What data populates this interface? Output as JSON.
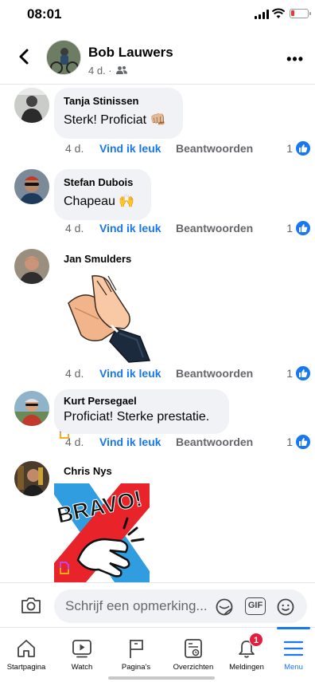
{
  "status_bar": {
    "time": "08:01"
  },
  "header": {
    "author": "Bob Lauwers",
    "meta": "4 d. ·",
    "audience_icon": "friends-icon",
    "back_icon": "chevron-left-icon",
    "more_label": "•••"
  },
  "comments": [
    {
      "author": "Tanja Stinissen",
      "text": "Sterk! Proficiat 👊🏼",
      "age": "4 d.",
      "like_label": "Vind ik leuk",
      "reply_label": "Beantwoorden",
      "reactions": "1"
    },
    {
      "author": "Stefan Dubois",
      "text": "Chapeau 🙌",
      "age": "4 d.",
      "like_label": "Vind ik leuk",
      "reply_label": "Beantwoorden",
      "reactions": "1"
    },
    {
      "author": "Jan Smulders",
      "text": "",
      "sticker": "clapping-hands",
      "age": "4 d.",
      "like_label": "Vind ik leuk",
      "reply_label": "Beantwoorden",
      "reactions": "1"
    },
    {
      "author": "Kurt Persegael",
      "text": "Proficiat! Sterke prestatie.",
      "age": "4 d.",
      "like_label": "Vind ik leuk",
      "reply_label": "Beantwoorden",
      "reactions": "1"
    },
    {
      "author": "Chris Nys",
      "text": "",
      "sticker": "bravo-clap",
      "sticker_text": "BRAVO!"
    }
  ],
  "composer": {
    "placeholder": "Schrijf een opmerking...",
    "gif_label": "GIF"
  },
  "tabs": [
    {
      "label": "Startpagina",
      "icon": "home-icon"
    },
    {
      "label": "Watch",
      "icon": "watch-icon"
    },
    {
      "label": "Pagina's",
      "icon": "flag-icon"
    },
    {
      "label": "Overzichten",
      "icon": "feeds-icon"
    },
    {
      "label": "Meldingen",
      "icon": "bell-icon",
      "badge": "1"
    },
    {
      "label": "Menu",
      "icon": "menu-icon",
      "active": true
    }
  ],
  "colors": {
    "accent": "#1877f2",
    "bubble": "#f0f2f5",
    "secondary_text": "#65676b",
    "badge": "#e41e3f"
  }
}
